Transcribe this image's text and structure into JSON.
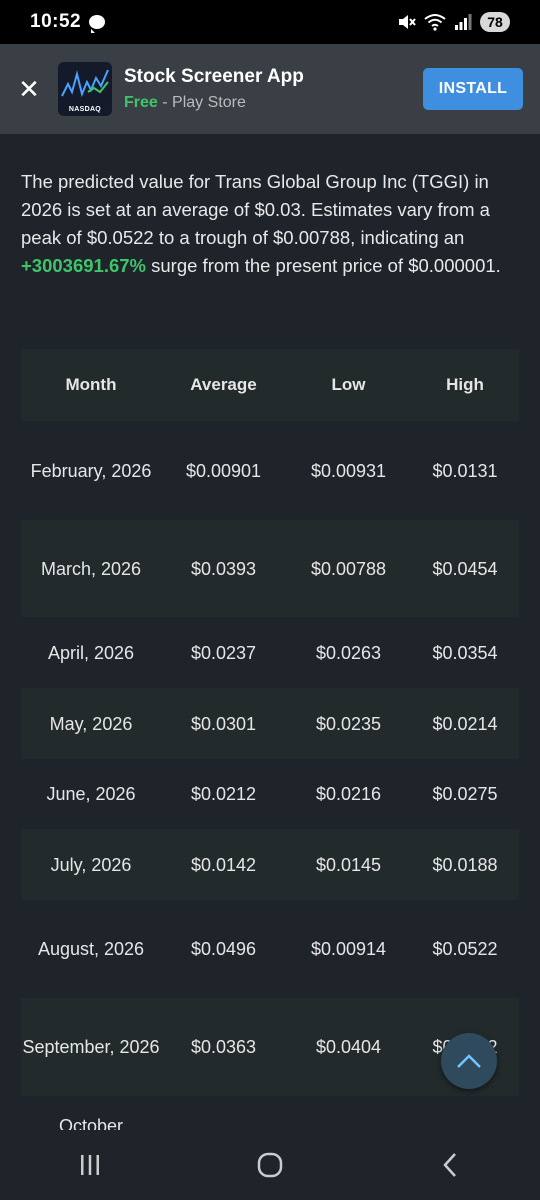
{
  "status_bar": {
    "time": "10:52",
    "battery": "78",
    "icons": [
      "chat-bubble-icon",
      "mute-icon",
      "wifi-icon",
      "signal-icon"
    ]
  },
  "ad": {
    "title": "Stock Screener App",
    "price_label": "Free",
    "store_label": "- Play Store",
    "logo_text": "NASDAQ",
    "install_label": "INSTALL",
    "close_label": "✕"
  },
  "intro": {
    "text_before": "The predicted value for Trans Global Group Inc (TGGI) in 2026 is set at an average of $0.03. Estimates vary from a peak of $0.0522 to a trough of $0.00788, indicating an",
    "percent": "+3003691.67%",
    "text_after": "surge from the present price of $0.000001."
  },
  "table": {
    "headers": [
      "Month",
      "Average",
      "Low",
      "High"
    ],
    "rows": [
      {
        "month": "February, 2026",
        "average": "$0.00901",
        "low": "$0.00931",
        "high": "$0.0131"
      },
      {
        "month": "March, 2026",
        "average": "$0.0393",
        "low": "$0.00788",
        "high": "$0.0454"
      },
      {
        "month": "April, 2026",
        "average": "$0.0237",
        "low": "$0.0263",
        "high": "$0.0354"
      },
      {
        "month": "May, 2026",
        "average": "$0.0301",
        "low": "$0.0235",
        "high": "$0.0214"
      },
      {
        "month": "June, 2026",
        "average": "$0.0212",
        "low": "$0.0216",
        "high": "$0.0275"
      },
      {
        "month": "July, 2026",
        "average": "$0.0142",
        "low": "$0.0145",
        "high": "$0.0188"
      },
      {
        "month": "August, 2026",
        "average": "$0.0496",
        "low": "$0.00914",
        "high": "$0.0522"
      },
      {
        "month": "September, 2026",
        "average": "$0.0363",
        "low": "$0.0404",
        "high": "$0.0422"
      },
      {
        "month": "October",
        "average": "",
        "low": "",
        "high": ""
      }
    ]
  },
  "colors": {
    "background": "#1f242b",
    "accent_green": "#3fc46a",
    "install_blue": "#3f8fe0",
    "row_shade": "#232a2c"
  }
}
